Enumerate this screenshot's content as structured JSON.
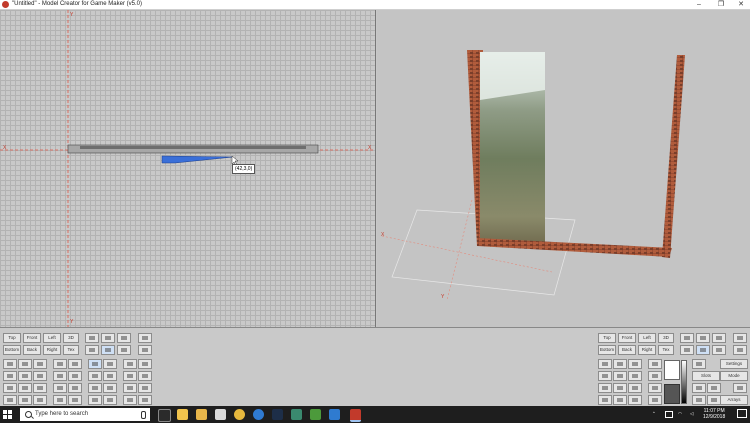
{
  "window": {
    "title": "\"Untitled\" - Model Creator for Game Maker (v5.0)",
    "controls": [
      "–",
      "❐",
      "✕"
    ]
  },
  "viewport_2d": {
    "axis_x_label_left": "X",
    "axis_x_label_right": "X",
    "axis_y_label_top": "Y",
    "axis_y_label_bottom": "Y",
    "coordinate_tooltip": "(42,3,0)",
    "grid_color": "#b3b3b3",
    "axis_color": "#e05a4a",
    "selection_color": "#3a6fd8"
  },
  "viewport_3d": {
    "axis_x_label": "X",
    "axis_y_label": "Y",
    "axis_x_label_2": "X"
  },
  "toolbar": {
    "view_buttons_row1": [
      "Top",
      "Front",
      "Left",
      "3D"
    ],
    "view_buttons_row2": [
      "Bottom",
      "Back",
      "Right",
      "Tex"
    ],
    "right_view_buttons_row1": [
      "Top",
      "Front",
      "Left",
      "3D"
    ],
    "right_view_buttons_row2": [
      "Bottom",
      "Back",
      "Right",
      "Tex"
    ],
    "right_wide_buttons": [
      "Settings",
      "Slots",
      "Mode",
      "Arrays"
    ]
  },
  "taskbar": {
    "search_placeholder": "Type here to search",
    "time": "11:07 PM",
    "date": "12/9/2018"
  }
}
